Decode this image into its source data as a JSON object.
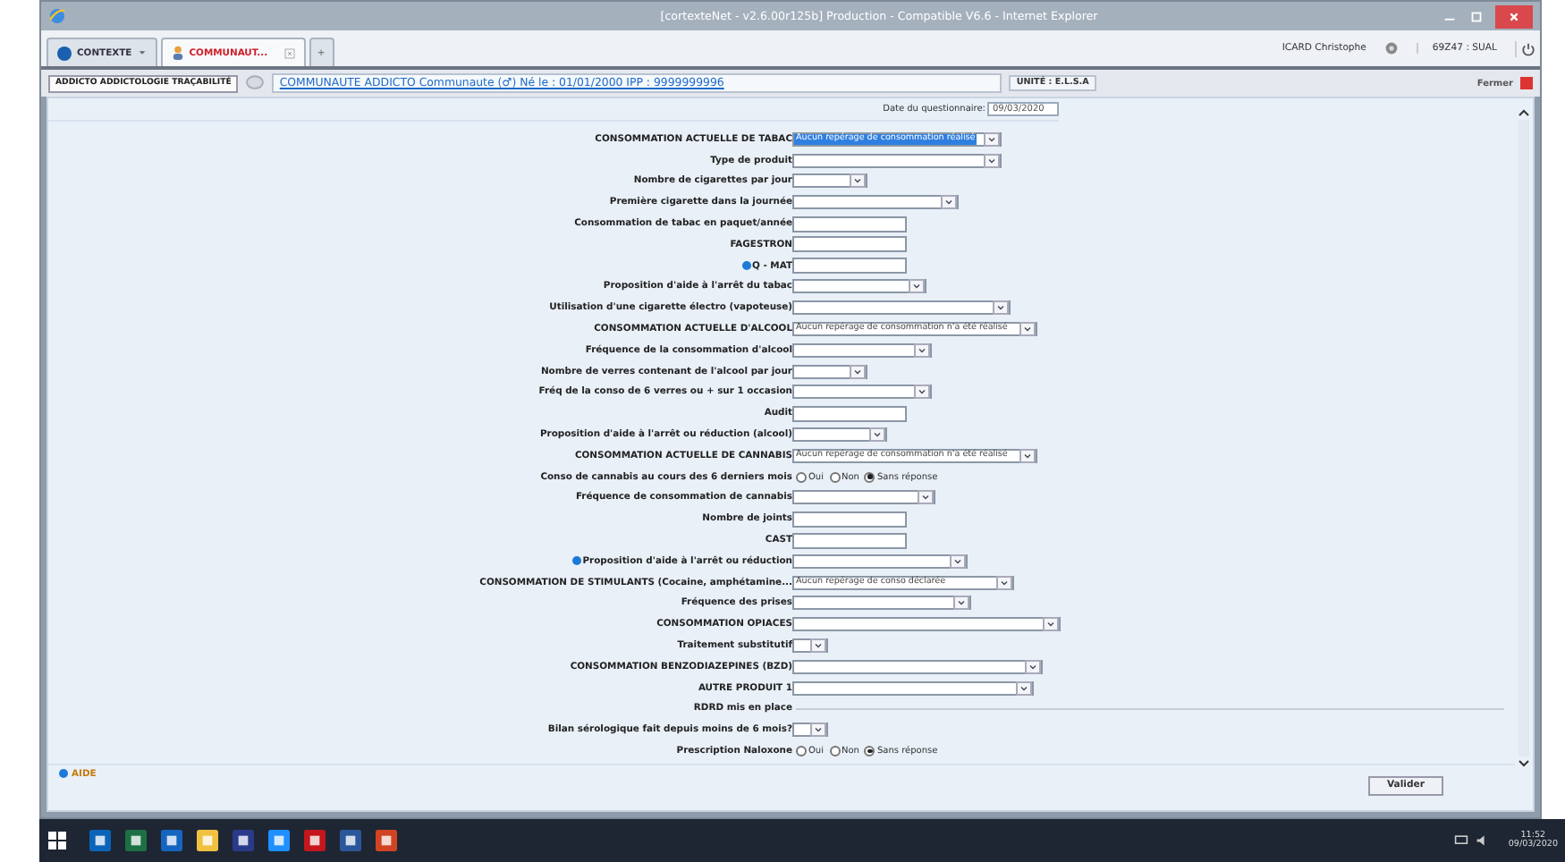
{
  "window": {
    "title": "[cortexteNet - v2.6.00r125b] Production - Compatible V6.6 - Internet Explorer"
  },
  "tabs": [
    {
      "kind": "menu",
      "label": "CONTEXTE",
      "selected": false
    },
    {
      "kind": "patient",
      "label": "COMMUNAUT...",
      "selected": true
    },
    {
      "kind": "new",
      "label": "+",
      "selected": false
    }
  ],
  "user": {
    "name": "ICARD Christophe",
    "unit": "69Z47 : SUAL"
  },
  "breadcrumb": {
    "module": "ADDICTO ADDICTOLOGIE TRAÇABILITÉ",
    "patient": "COMMUNAUTE ADDICTO Communaute (♂) Né le : 01/01/2000 IPP : 9999999996",
    "unit": "UNITÉ : E.L.S.A",
    "close": "Fermer"
  },
  "date": {
    "label": "Date du questionnaire:",
    "value": "09/03/2020"
  },
  "rows": [
    {
      "kind": "select",
      "label": "CONSOMMATION ACTUELLE DE TABAC",
      "value": "Aucun repérage de consommation réalisé",
      "focused": true
    },
    {
      "kind": "select",
      "label": "Type de produit"
    },
    {
      "kind": "select",
      "label": "Nombre de cigarettes par jour"
    },
    {
      "kind": "select",
      "label": "Première cigarette dans la journée"
    },
    {
      "kind": "text",
      "label": "Consommation de tabac en paquet/année"
    },
    {
      "kind": "text",
      "label": "FAGESTRON"
    },
    {
      "kind": "text",
      "label": "Q - MAT",
      "info": true
    },
    {
      "kind": "select",
      "label": "Proposition d'aide à l'arrêt du tabac"
    },
    {
      "kind": "select",
      "label": "Utilisation d'une cigarette électro (vapoteuse)"
    },
    {
      "kind": "select",
      "label": "CONSOMMATION ACTUELLE D'ALCOOL",
      "value": "Aucun repérage de consommation n'a été réalisé"
    },
    {
      "kind": "select",
      "label": "Fréquence de la consommation d'alcool"
    },
    {
      "kind": "select",
      "label": "Nombre de verres contenant de l'alcool par jour"
    },
    {
      "kind": "select",
      "label": "Fréq de la conso de 6 verres ou + sur 1 occasion"
    },
    {
      "kind": "text",
      "label": "Audit"
    },
    {
      "kind": "select",
      "label": "Proposition d'aide à l'arrêt ou réduction (alcool)"
    },
    {
      "kind": "select",
      "label": "CONSOMMATION ACTUELLE DE CANNABIS",
      "value": "Aucun repérage de consommation n'a été réalisé"
    },
    {
      "kind": "radio",
      "label": "Conso de cannabis au cours des 6 derniers mois",
      "options": [
        {
          "label": "Oui",
          "selected": false
        },
        {
          "label": "Non",
          "selected": false
        },
        {
          "label": "Sans réponse",
          "selected": true
        }
      ]
    },
    {
      "kind": "select",
      "label": "Fréquence de consommation de cannabis"
    },
    {
      "kind": "text",
      "label": "Nombre de joints"
    },
    {
      "kind": "text",
      "label": "CAST"
    },
    {
      "kind": "select",
      "label": "Proposition d'aide à l'arrêt ou réduction",
      "info": true
    },
    {
      "kind": "select",
      "label": "CONSOMMATION DE STIMULANTS (Cocaine, amphétamine...",
      "value": "Aucun repérage de conso déclarée"
    },
    {
      "kind": "select",
      "label": "Fréquence des prises"
    },
    {
      "kind": "select",
      "label": "CONSOMMATION OPIACES"
    },
    {
      "kind": "select",
      "label": "Traitement substitutif"
    },
    {
      "kind": "select",
      "label": "CONSOMMATION BENZODIAZEPINES (BZD)"
    },
    {
      "kind": "select",
      "label": "AUTRE PRODUIT 1"
    },
    {
      "kind": "section",
      "label": "RDRD mis en place"
    },
    {
      "kind": "select",
      "label": "Bilan sérologique fait depuis moins de 6 mois?"
    },
    {
      "kind": "radio",
      "label": "Prescription Naloxone",
      "options": [
        {
          "label": "Oui",
          "selected": false
        },
        {
          "label": "Non",
          "selected": false
        },
        {
          "label": "Sans réponse",
          "selected": true
        }
      ]
    }
  ],
  "footer": {
    "help": "AIDE",
    "submit": "Valider"
  },
  "clock": {
    "time": "11:52",
    "date": "09/03/2020"
  }
}
